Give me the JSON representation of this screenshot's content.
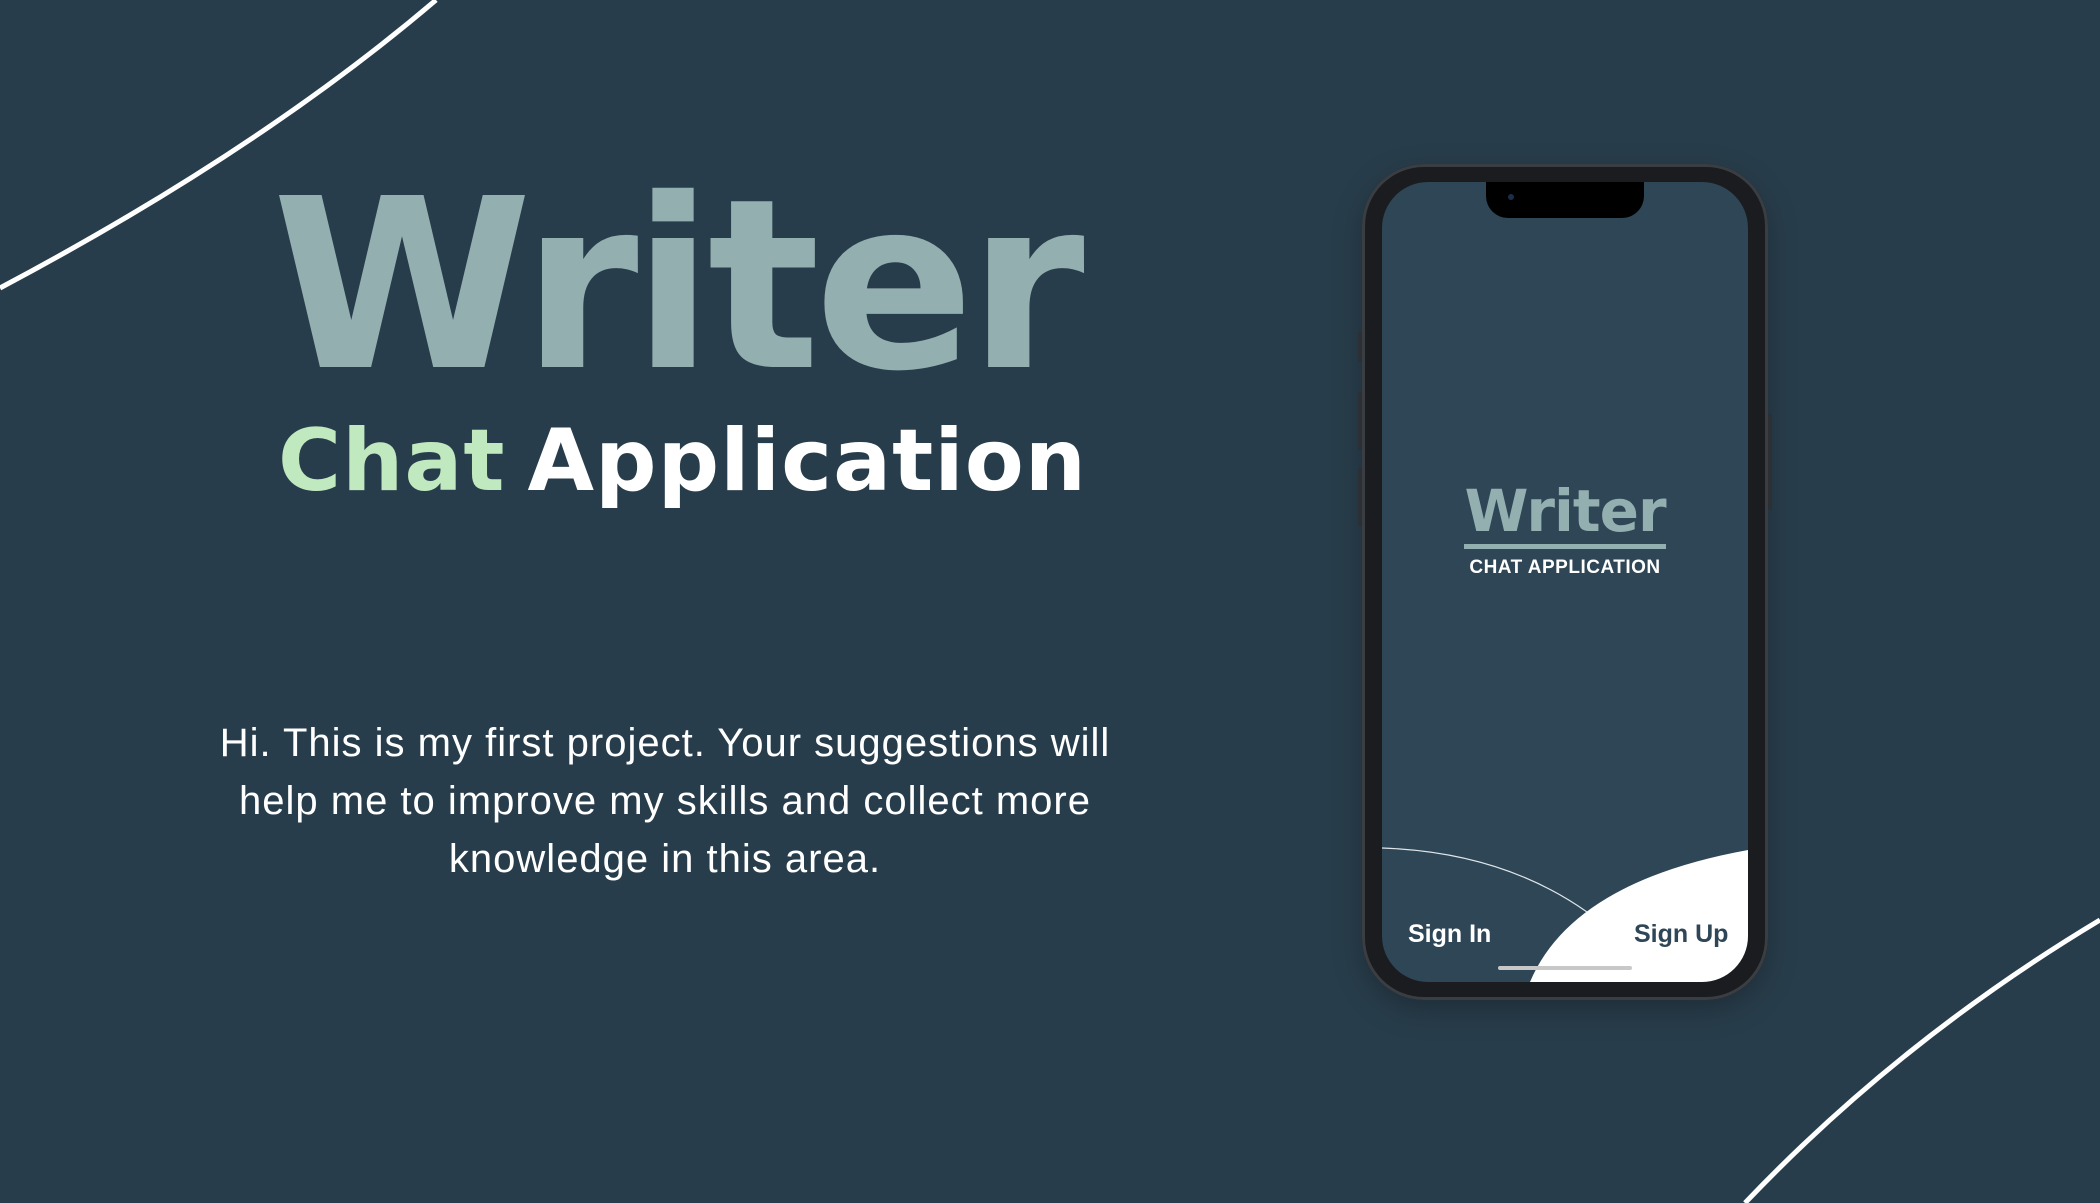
{
  "hero": {
    "title": "Writer",
    "subtitle_word1": "Chat",
    "subtitle_word2": "Application",
    "description": "Hi. This is my first project. Your suggestions will help me to improve my skills and collect more knowledge in this area."
  },
  "phone": {
    "logo_title": "Writer",
    "logo_subtitle": "CHAT APPLICATION",
    "sign_in_label": "Sign In",
    "sign_up_label": "Sign Up"
  },
  "colors": {
    "background": "#283d4b",
    "title": "#94afb0",
    "accent_green": "#c1e9c0",
    "screen": "#2e4656",
    "white": "#ffffff"
  }
}
